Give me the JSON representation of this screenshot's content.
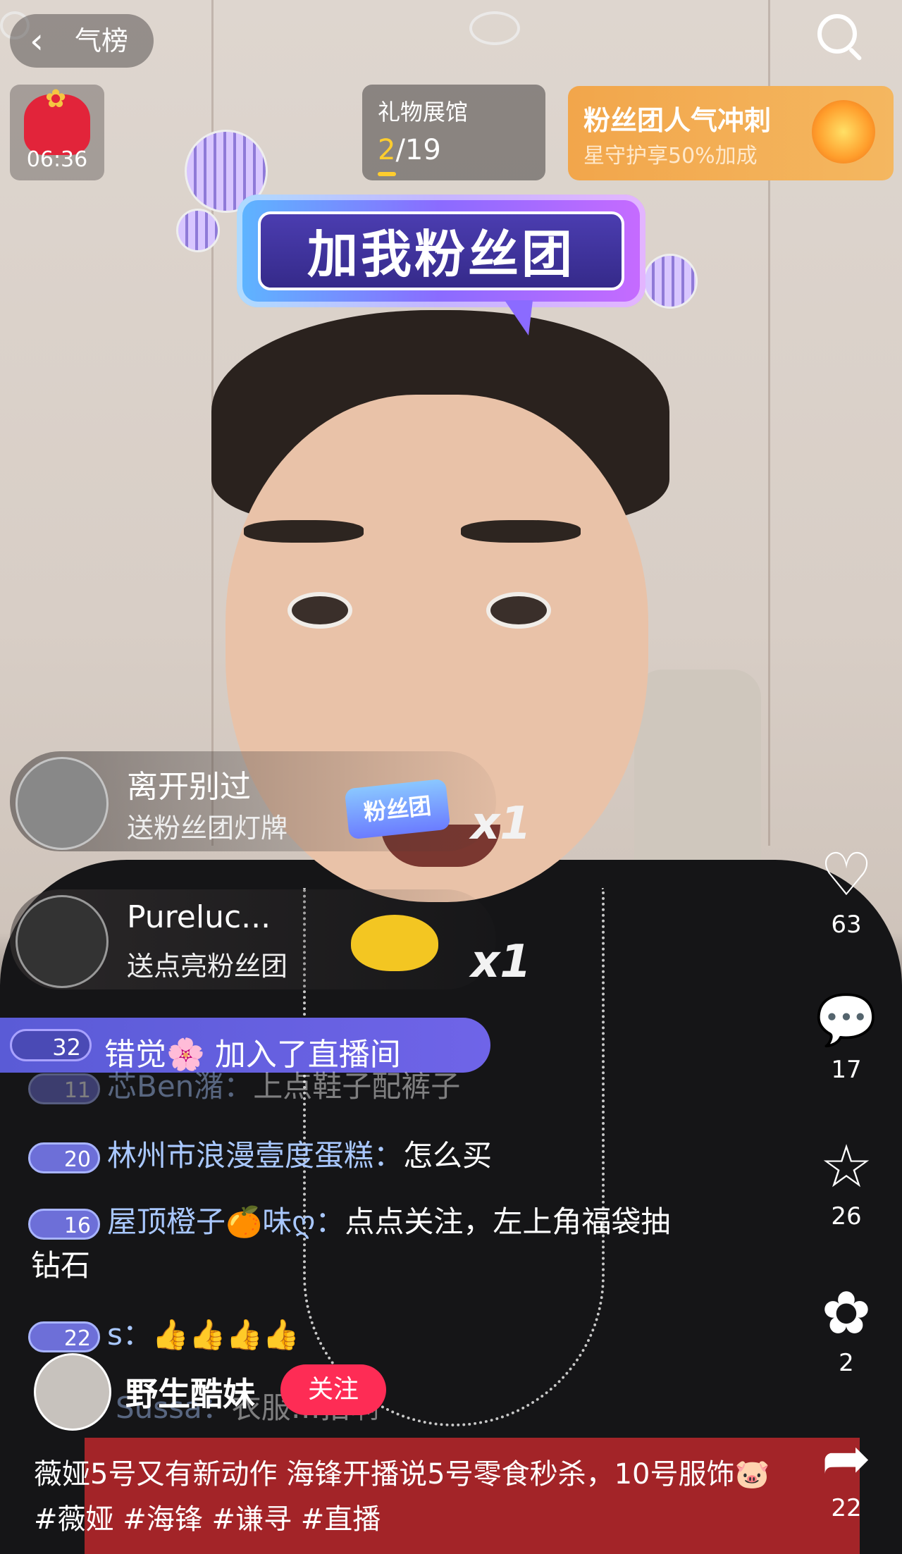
{
  "top_bar": {
    "back_label": "气榜"
  },
  "lucky_bag": {
    "timer": "06:36"
  },
  "gift_gallery": {
    "title": "礼物展馆",
    "current": "2",
    "total": "/19"
  },
  "fan_sprint": {
    "title": "粉丝团人气冲刺",
    "subtitle": "星守护享50%加成"
  },
  "banner": {
    "text": "加我粉丝团"
  },
  "gift_notices": [
    {
      "user": "离开别过",
      "action": "送粉丝团灯牌",
      "badge": "粉丝团",
      "count": "x1"
    },
    {
      "user": "Pureluc...",
      "action": "送点亮粉丝团",
      "count": "x1"
    }
  ],
  "join_notice": {
    "level": "32",
    "text": "错觉🌸 加入了直播间"
  },
  "chat": [
    {
      "level": "11",
      "user": "芯Ben潴：",
      "text": "上点鞋子配裤子"
    },
    {
      "level": "20",
      "user": "林州市浪漫壹度蛋糕：",
      "text": "怎么买"
    },
    {
      "level": "16",
      "user": "屋顶橙子🍊味ღ：",
      "text": "点点关注，左上角福袋抽",
      "cont": "钻石"
    },
    {
      "level": "22",
      "user": "s：",
      "text": "👍👍👍👍"
    },
    {
      "user": "Sussa：",
      "text": "衣服…拍啊"
    }
  ],
  "actions": [
    {
      "icon": "heart-icon",
      "glyph": "♡",
      "count": "63"
    },
    {
      "icon": "comment-icon",
      "glyph": "💬",
      "count": "17"
    },
    {
      "icon": "star-icon",
      "glyph": "☆",
      "count": "26"
    },
    {
      "icon": "share-gift-icon",
      "glyph": "✿",
      "count": "2"
    },
    {
      "icon": "share-icon",
      "glyph": "➦",
      "count": "22"
    }
  ],
  "author": {
    "name": "野生酷妹",
    "follow_label": "关注"
  },
  "caption": {
    "text": "薇娅5号又有新动作 海锋开播说5号零食秒杀，10号服饰🐷 #薇娅 #海锋 #谦寻 #直播"
  },
  "colors": {
    "follow": "#fe2c55",
    "join_bg": "#6f64e8",
    "sprint_bg": "#f2a64b",
    "gallery_accent": "#ffcd2e"
  }
}
